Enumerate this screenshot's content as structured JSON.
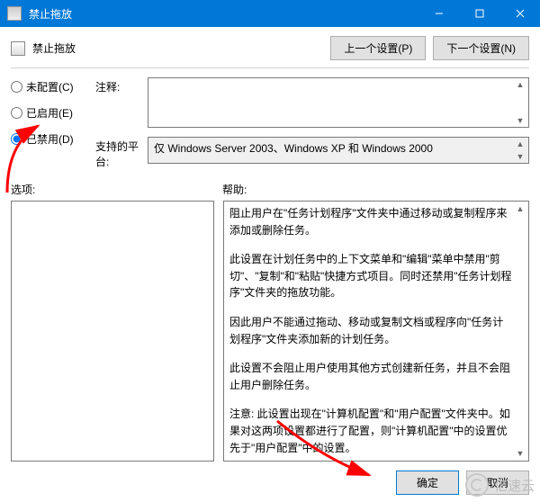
{
  "titlebar": {
    "title": "禁止拖放"
  },
  "header": {
    "title": "禁止拖放",
    "prev": "上一个设置(P)",
    "next": "下一个设置(N)"
  },
  "radios": {
    "not_configured": "未配置(C)",
    "enabled": "已启用(E)",
    "disabled": "已禁用(D)"
  },
  "fields": {
    "comment_label": "注释:",
    "platform_label": "支持的平台:",
    "platform_value": "仅 Windows Server 2003、Windows XP 和 Windows 2000"
  },
  "labels": {
    "options": "选项:",
    "help": "帮助:"
  },
  "help": {
    "p1": "阻止用户在\"任务计划程序\"文件夹中通过移动或复制程序来添加或删除任务。",
    "p2": "此设置在计划任务中的上下文菜单和\"编辑\"菜单中禁用\"剪切\"、\"复制\"和\"粘贴\"快捷方式项目。同时还禁用\"任务计划程序\"文件夹的拖放功能。",
    "p3": "因此用户不能通过拖动、移动或复制文档或程序向\"任务计划程序\"文件夹添加新的计划任务。",
    "p4": "此设置不会阻止用户使用其他方式创建新任务，并且不会阻止用户删除任务。",
    "p5": "注意: 此设置出现在\"计算机配置\"和\"用户配置\"文件夹中。如果对这两项设置都进行了配置，则\"计算机配置\"中的设置优先于\"用户配置\"中的设置。"
  },
  "footer": {
    "ok": "确定",
    "cancel": "取消"
  },
  "watermark": {
    "text": "亿速云"
  }
}
